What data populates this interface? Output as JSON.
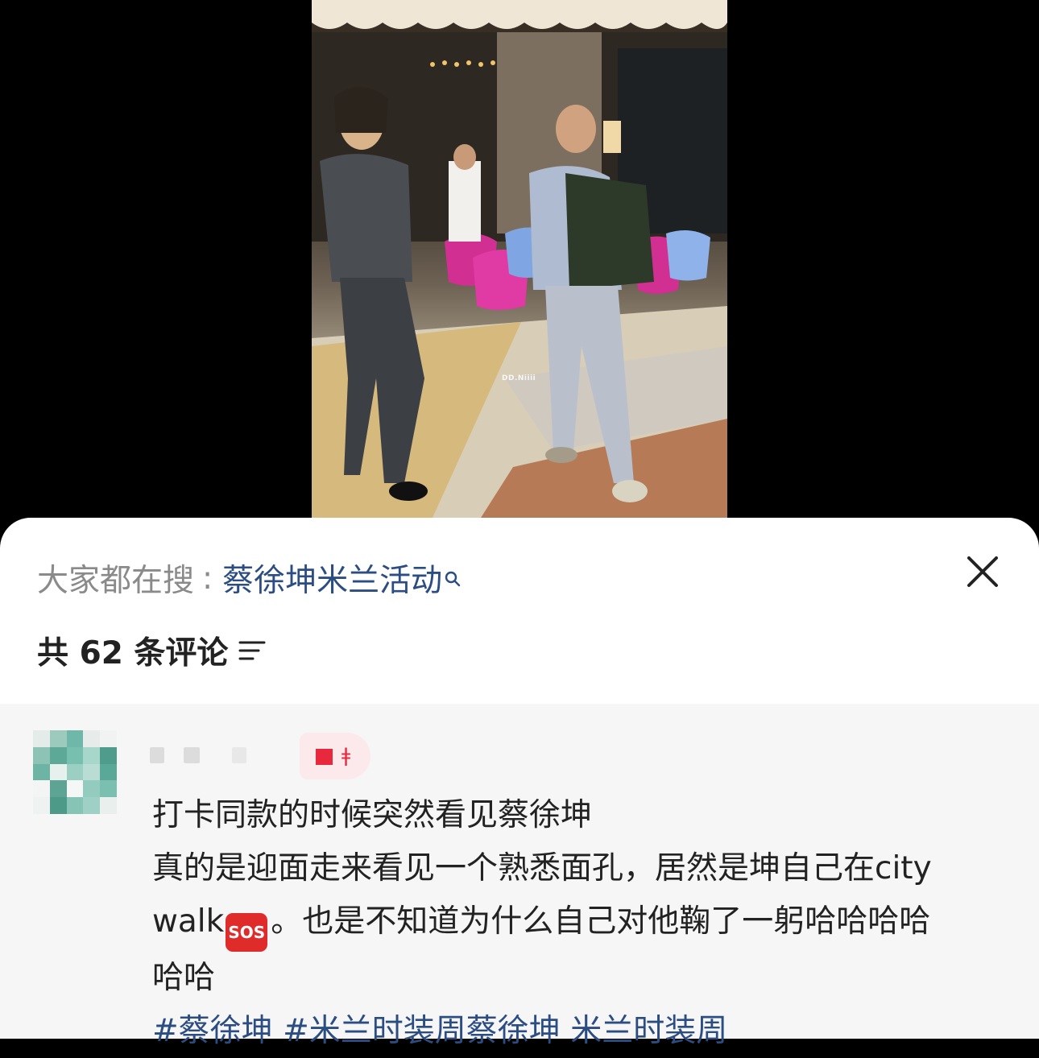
{
  "video": {
    "watermark": "DD.Niiii"
  },
  "search_bar": {
    "prefix": "大家都在搜",
    "separator": ":",
    "term": "蔡徐坤米兰活动",
    "icon": "search-icon"
  },
  "close_icon": "close-icon",
  "comments_header": {
    "label": "共 62 条评论",
    "sort_icon": "sort-icon"
  },
  "comment": {
    "avatar_icon": "avatar",
    "badge_icon": "badge-icon",
    "line1": "打卡同款的时候突然看见蔡徐坤",
    "line2": "真的是迎面走来看见一个熟悉面孔，居然是坤自己在city",
    "line3_start": "walk",
    "emoji": "SOS",
    "line3_end": "。也是不知道为什么自己对他鞠了一躬哈哈哈哈",
    "line4": "哈哈",
    "tags": [
      "#蔡徐坤",
      "#米兰时装周蔡徐坤",
      "米兰时装周"
    ]
  },
  "colors": {
    "link_blue": "#2c4d82",
    "sos_red": "#e02b2b",
    "badge_red": "#e8283c",
    "comment_bg": "#f6f6f6"
  }
}
